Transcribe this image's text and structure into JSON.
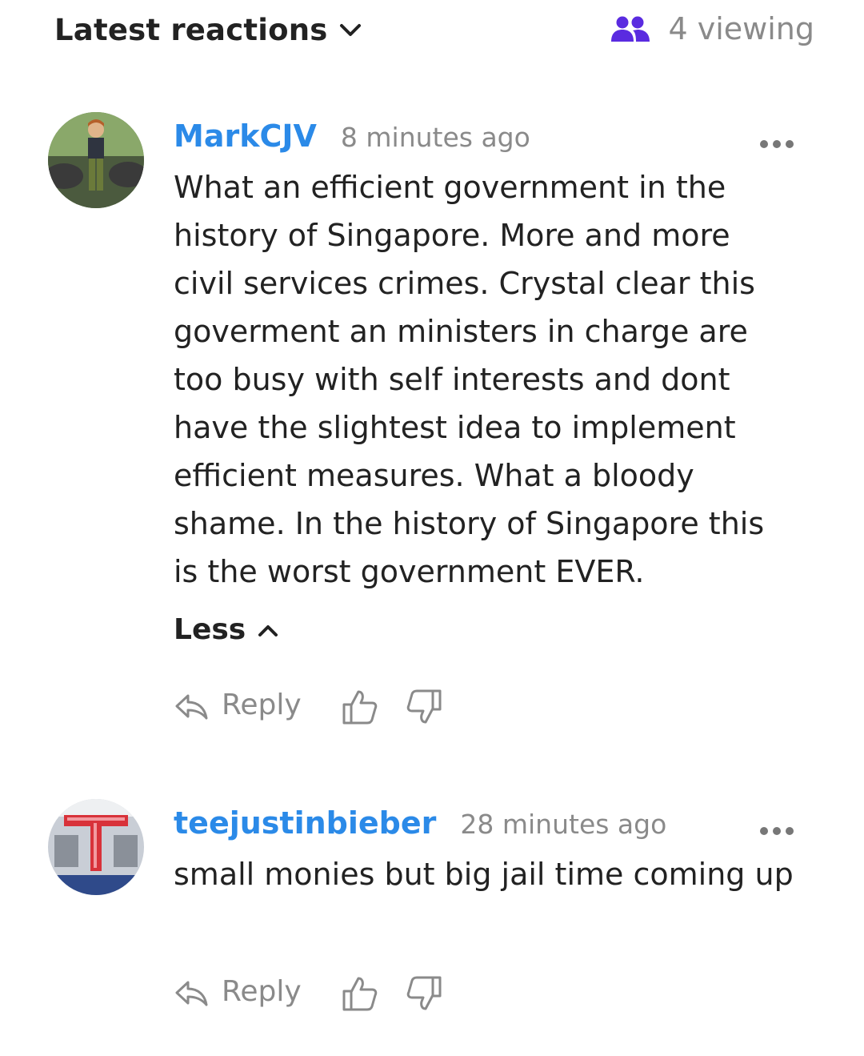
{
  "header": {
    "sort_label": "Latest reactions",
    "viewing_text": "4 viewing"
  },
  "comments": [
    {
      "author": "MarkCJV",
      "time": "8 minutes ago",
      "text": "What an efficient government in the history of Singapore. More and more civil services crimes. Crystal clear this goverment an ministers in charge are too busy with self interests and dont have the slightest idea to implement efficient measures. What a bloody shame. In the history of Singapore this is the worst government EVER.",
      "less_label": "Less",
      "reply_label": "Reply"
    },
    {
      "author": "teejustinbieber",
      "time": "28 minutes ago",
      "text": "small monies but big jail time coming up",
      "reply_label": "Reply"
    }
  ],
  "colors": {
    "author": "#2b8ae8",
    "viewing_icon": "#5a2be0",
    "muted": "#8a8a8a",
    "text": "#222222"
  },
  "icons": {
    "sort_chevron": "chevron-down-icon",
    "viewing": "users-icon",
    "more": "more-dots-icon",
    "less_chevron": "chevron-up-icon",
    "reply": "reply-arrow-icon",
    "like": "thumbs-up-icon",
    "dislike": "thumbs-down-icon"
  }
}
